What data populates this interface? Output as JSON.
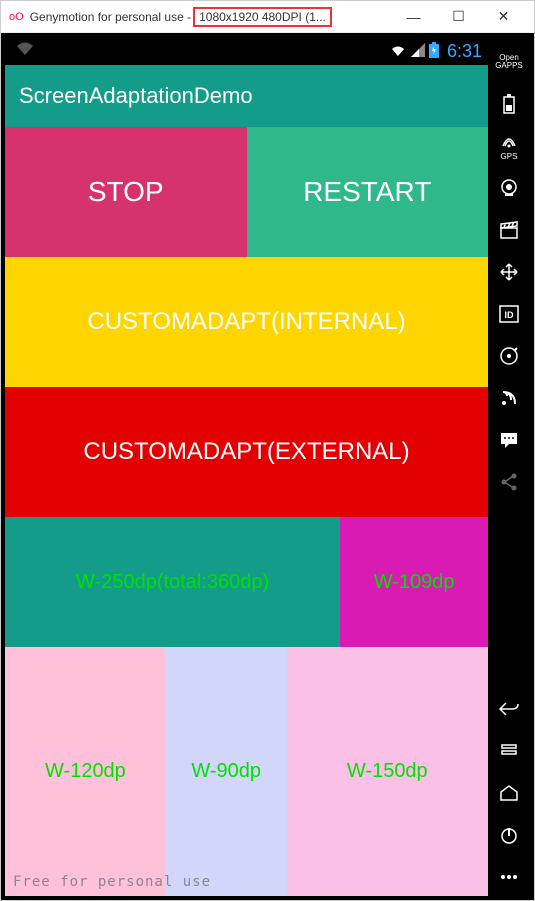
{
  "titlebar": {
    "logo": "oO",
    "prefix": "Genymotion for personal use -",
    "highlight": "1080x1920 480DPI (1...",
    "minimize": "—",
    "maximize": "☐",
    "close": "✕"
  },
  "statusbar": {
    "time": "6:31"
  },
  "appbar": {
    "title": "ScreenAdaptationDemo"
  },
  "buttons": {
    "stop": "STOP",
    "restart": "RESTART",
    "internal": "CUSTOMADAPT(INTERNAL)",
    "external": "CUSTOMADAPT(EXTERNAL)"
  },
  "widths": {
    "w250": "W-250dp(total:360dp)",
    "w109": "W-109dp",
    "w120": "W-120dp",
    "w90": "W-90dp",
    "w150": "W-150dp"
  },
  "watermark": "Free for personal use",
  "sidebar": {
    "opengapps_l1": "Open",
    "opengapps_l2": "GAPPS",
    "gps": "GPS",
    "id": "ID"
  }
}
